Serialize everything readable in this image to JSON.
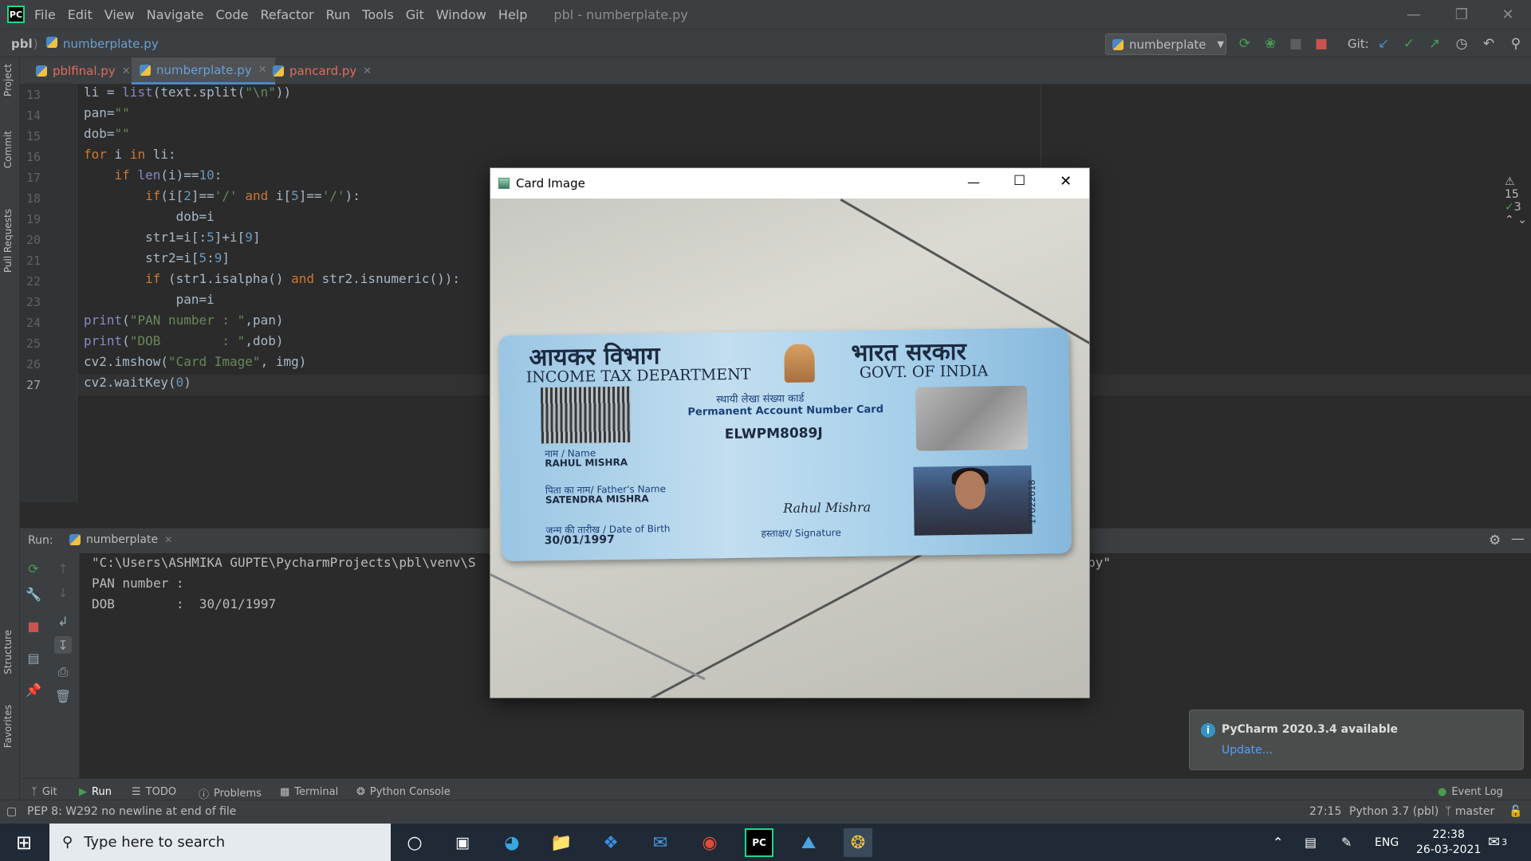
{
  "app": {
    "logo_text": "PC",
    "menu": [
      "File",
      "Edit",
      "View",
      "Navigate",
      "Code",
      "Refactor",
      "Run",
      "Tools",
      "Git",
      "Window",
      "Help"
    ],
    "window_title": "pbl - numberplate.py"
  },
  "navbar": {
    "project": "pbl",
    "file": "numberplate.py",
    "run_config": "numberplate",
    "git_label": "Git:"
  },
  "left_strip": {
    "project": "Project",
    "commit": "Commit",
    "pull_requests": "Pull Requests",
    "structure": "Structure",
    "favorites": "Favorites"
  },
  "tabs": [
    {
      "label": "pblfinal.py",
      "color": "#e06c5b"
    },
    {
      "label": "numberplate.py",
      "color": "#6a9fd6"
    },
    {
      "label": "pancard.py",
      "color": "#e06c5b"
    }
  ],
  "editor": {
    "line_numbers": [
      "13",
      "14",
      "15",
      "16",
      "17",
      "18",
      "19",
      "20",
      "21",
      "22",
      "23",
      "24",
      "25",
      "26",
      "27"
    ],
    "inspections": {
      "warnings": "15",
      "weak": "3"
    }
  },
  "run": {
    "label": "Run:",
    "tab": "numberplate",
    "output": [
      "\"C:\\Users\\ASHMIKA GUPTE\\PycharmProjects\\pbl\\venv\\S",
      "PAN number :",
      "DOB        :  30/01/1997"
    ],
    "output_tail": "py\""
  },
  "bottom_tabs": [
    "Git",
    "Run",
    "TODO",
    "Problems",
    "Terminal",
    "Python Console"
  ],
  "event_log": "Event Log",
  "status": {
    "message": "PEP 8: W292 no newline at end of file",
    "position": "27:15",
    "interpreter": "Python 3.7 (pbl)",
    "branch": "master"
  },
  "notification": {
    "title": "PyCharm 2020.3.4 available",
    "link": "Update..."
  },
  "card_window": {
    "title": "Card Image",
    "card": {
      "hindi_dept": "आयकर विभाग",
      "eng_dept": "INCOME TAX DEPARTMENT",
      "hindi_govt": "भारत सरकार",
      "eng_govt": "GOVT. OF INDIA",
      "hindi_pan": "स्थायी लेखा संख्या कार्ड",
      "eng_pan": "Permanent Account Number Card",
      "pan_number": "ELWPM8089J",
      "name_label": "नाम / Name",
      "name": "RAHUL MISHRA",
      "father_label": "पिता का नाम/ Father's Name",
      "father": "SATENDRA MISHRA",
      "dob_label": "जन्म की तारीख / Date of Birth",
      "dob": "30/01/1997",
      "signature_label": "हस्ताक्षर/ Signature",
      "signature": "Rahul Mishra",
      "serial": "17022018"
    }
  },
  "taskbar": {
    "search_placeholder": "Type here to search",
    "lang": "ENG",
    "time": "22:38",
    "date": "26-03-2021",
    "notif_count": "3"
  }
}
